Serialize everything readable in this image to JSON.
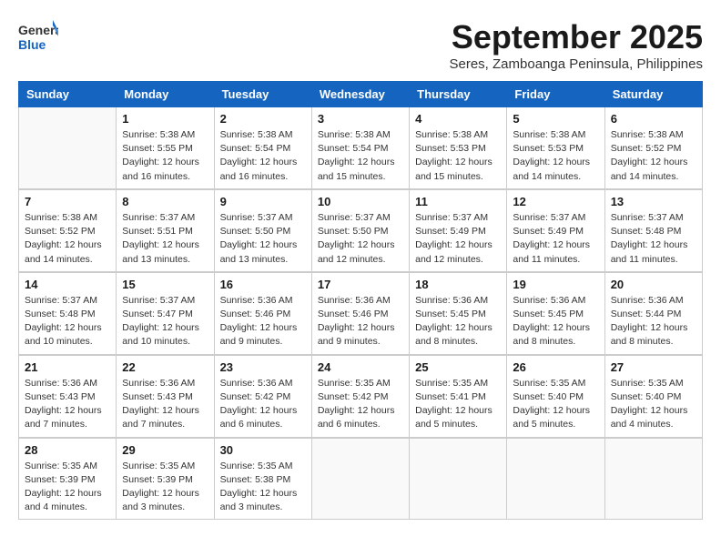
{
  "header": {
    "logo_general": "General",
    "logo_blue": "Blue",
    "month_title": "September 2025",
    "subtitle": "Seres, Zamboanga Peninsula, Philippines"
  },
  "days_of_week": [
    "Sunday",
    "Monday",
    "Tuesday",
    "Wednesday",
    "Thursday",
    "Friday",
    "Saturday"
  ],
  "weeks": [
    [
      {
        "day": "",
        "info": ""
      },
      {
        "day": "1",
        "info": "Sunrise: 5:38 AM\nSunset: 5:55 PM\nDaylight: 12 hours\nand 16 minutes."
      },
      {
        "day": "2",
        "info": "Sunrise: 5:38 AM\nSunset: 5:54 PM\nDaylight: 12 hours\nand 16 minutes."
      },
      {
        "day": "3",
        "info": "Sunrise: 5:38 AM\nSunset: 5:54 PM\nDaylight: 12 hours\nand 15 minutes."
      },
      {
        "day": "4",
        "info": "Sunrise: 5:38 AM\nSunset: 5:53 PM\nDaylight: 12 hours\nand 15 minutes."
      },
      {
        "day": "5",
        "info": "Sunrise: 5:38 AM\nSunset: 5:53 PM\nDaylight: 12 hours\nand 14 minutes."
      },
      {
        "day": "6",
        "info": "Sunrise: 5:38 AM\nSunset: 5:52 PM\nDaylight: 12 hours\nand 14 minutes."
      }
    ],
    [
      {
        "day": "7",
        "info": "Sunrise: 5:38 AM\nSunset: 5:52 PM\nDaylight: 12 hours\nand 14 minutes."
      },
      {
        "day": "8",
        "info": "Sunrise: 5:37 AM\nSunset: 5:51 PM\nDaylight: 12 hours\nand 13 minutes."
      },
      {
        "day": "9",
        "info": "Sunrise: 5:37 AM\nSunset: 5:50 PM\nDaylight: 12 hours\nand 13 minutes."
      },
      {
        "day": "10",
        "info": "Sunrise: 5:37 AM\nSunset: 5:50 PM\nDaylight: 12 hours\nand 12 minutes."
      },
      {
        "day": "11",
        "info": "Sunrise: 5:37 AM\nSunset: 5:49 PM\nDaylight: 12 hours\nand 12 minutes."
      },
      {
        "day": "12",
        "info": "Sunrise: 5:37 AM\nSunset: 5:49 PM\nDaylight: 12 hours\nand 11 minutes."
      },
      {
        "day": "13",
        "info": "Sunrise: 5:37 AM\nSunset: 5:48 PM\nDaylight: 12 hours\nand 11 minutes."
      }
    ],
    [
      {
        "day": "14",
        "info": "Sunrise: 5:37 AM\nSunset: 5:48 PM\nDaylight: 12 hours\nand 10 minutes."
      },
      {
        "day": "15",
        "info": "Sunrise: 5:37 AM\nSunset: 5:47 PM\nDaylight: 12 hours\nand 10 minutes."
      },
      {
        "day": "16",
        "info": "Sunrise: 5:36 AM\nSunset: 5:46 PM\nDaylight: 12 hours\nand 9 minutes."
      },
      {
        "day": "17",
        "info": "Sunrise: 5:36 AM\nSunset: 5:46 PM\nDaylight: 12 hours\nand 9 minutes."
      },
      {
        "day": "18",
        "info": "Sunrise: 5:36 AM\nSunset: 5:45 PM\nDaylight: 12 hours\nand 8 minutes."
      },
      {
        "day": "19",
        "info": "Sunrise: 5:36 AM\nSunset: 5:45 PM\nDaylight: 12 hours\nand 8 minutes."
      },
      {
        "day": "20",
        "info": "Sunrise: 5:36 AM\nSunset: 5:44 PM\nDaylight: 12 hours\nand 8 minutes."
      }
    ],
    [
      {
        "day": "21",
        "info": "Sunrise: 5:36 AM\nSunset: 5:43 PM\nDaylight: 12 hours\nand 7 minutes."
      },
      {
        "day": "22",
        "info": "Sunrise: 5:36 AM\nSunset: 5:43 PM\nDaylight: 12 hours\nand 7 minutes."
      },
      {
        "day": "23",
        "info": "Sunrise: 5:36 AM\nSunset: 5:42 PM\nDaylight: 12 hours\nand 6 minutes."
      },
      {
        "day": "24",
        "info": "Sunrise: 5:35 AM\nSunset: 5:42 PM\nDaylight: 12 hours\nand 6 minutes."
      },
      {
        "day": "25",
        "info": "Sunrise: 5:35 AM\nSunset: 5:41 PM\nDaylight: 12 hours\nand 5 minutes."
      },
      {
        "day": "26",
        "info": "Sunrise: 5:35 AM\nSunset: 5:40 PM\nDaylight: 12 hours\nand 5 minutes."
      },
      {
        "day": "27",
        "info": "Sunrise: 5:35 AM\nSunset: 5:40 PM\nDaylight: 12 hours\nand 4 minutes."
      }
    ],
    [
      {
        "day": "28",
        "info": "Sunrise: 5:35 AM\nSunset: 5:39 PM\nDaylight: 12 hours\nand 4 minutes."
      },
      {
        "day": "29",
        "info": "Sunrise: 5:35 AM\nSunset: 5:39 PM\nDaylight: 12 hours\nand 3 minutes."
      },
      {
        "day": "30",
        "info": "Sunrise: 5:35 AM\nSunset: 5:38 PM\nDaylight: 12 hours\nand 3 minutes."
      },
      {
        "day": "",
        "info": ""
      },
      {
        "day": "",
        "info": ""
      },
      {
        "day": "",
        "info": ""
      },
      {
        "day": "",
        "info": ""
      }
    ]
  ]
}
